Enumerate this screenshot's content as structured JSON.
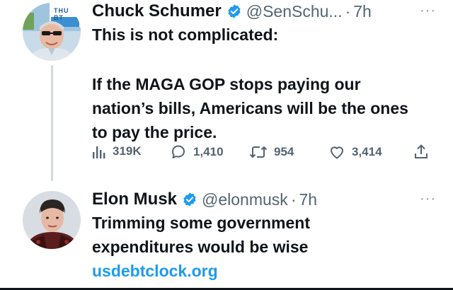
{
  "tweets": [
    {
      "author": {
        "name": "Chuck Schumer",
        "handle": "@SenSchu...",
        "time": "7h",
        "avatar": "portrait with sunglasses at a parade",
        "avatar_sign_text": "THU BT"
      },
      "text_lines": [
        "This is not complicated:",
        "If the MAGA GOP stops paying our nation’s bills, Americans will be the ones to pay the price."
      ],
      "actions": {
        "views": "319K",
        "replies": "1,410",
        "retweets": "954",
        "likes": "3,414"
      }
    },
    {
      "author": {
        "name": "Elon Musk",
        "handle": "@elonmusk",
        "time": "7h",
        "avatar": "portrait in dark red outfit"
      },
      "text_lines": [
        "Trimming some government expenditures would be wise"
      ],
      "link": "usdebtclock.org"
    }
  ],
  "separator": "·",
  "more_glyph": "···",
  "icons": {
    "verified": "verified-badge-icon",
    "views": "bar-chart-icon",
    "reply": "reply-bubble-icon",
    "retweet": "retweet-arrows-icon",
    "like": "heart-icon",
    "share": "share-upload-icon",
    "more": "more-dots-icon"
  },
  "colors": {
    "verified": "#1d9bf0",
    "link": "#1d9bf0",
    "text": "#0f1419",
    "muted": "#536471"
  }
}
